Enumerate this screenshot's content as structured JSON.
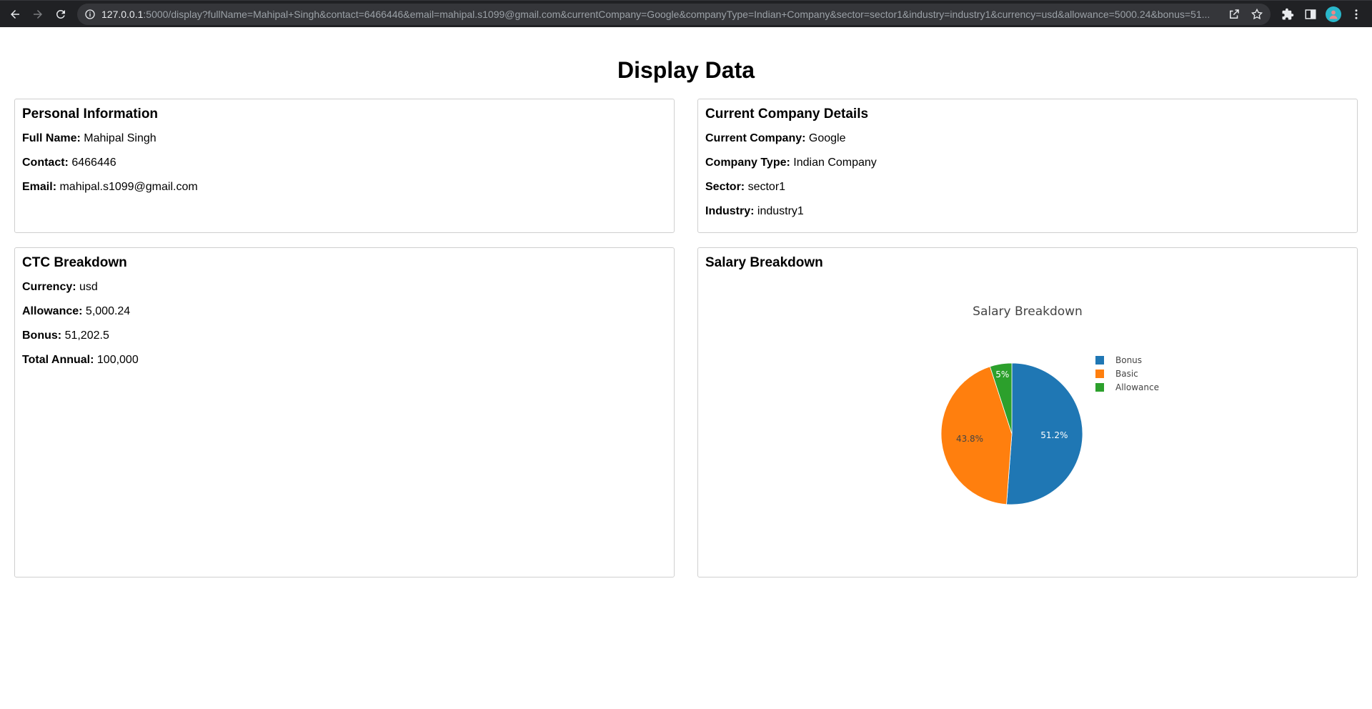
{
  "browser": {
    "url_host": "127.0.0.1",
    "url_rest": ":5000/display?fullName=Mahipal+Singh&contact=6466446&email=mahipal.s1099@gmail.com&currentCompany=Google&companyType=Indian+Company&sector=sector1&industry=industry1&currency=usd&allowance=5000.24&bonus=51..."
  },
  "page": {
    "title": "Display Data"
  },
  "personal": {
    "heading": "Personal Information",
    "full_name_label": "Full Name:",
    "full_name": "Mahipal Singh",
    "contact_label": "Contact:",
    "contact": "6466446",
    "email_label": "Email:",
    "email": "mahipal.s1099@gmail.com"
  },
  "company": {
    "heading": "Current Company Details",
    "current_company_label": "Current Company:",
    "current_company": "Google",
    "company_type_label": "Company Type:",
    "company_type": "Indian Company",
    "sector_label": "Sector:",
    "sector": "sector1",
    "industry_label": "Industry:",
    "industry": "industry1"
  },
  "ctc": {
    "heading": "CTC Breakdown",
    "currency_label": "Currency:",
    "currency": "usd",
    "allowance_label": "Allowance:",
    "allowance": "5,000.24",
    "bonus_label": "Bonus:",
    "bonus": "51,202.5",
    "total_label": "Total Annual:",
    "total": "100,000"
  },
  "salary": {
    "heading": "Salary Breakdown"
  },
  "chart_data": {
    "type": "pie",
    "title": "Salary Breakdown",
    "slices": [
      {
        "label": "Bonus",
        "value": 51202.5,
        "percent_label": "51.2%",
        "color": "#1f77b4",
        "text_color": "#ffffff"
      },
      {
        "label": "Basic",
        "value": 43797.26,
        "percent_label": "43.8%",
        "color": "#ff7f0e",
        "text_color": "#444444"
      },
      {
        "label": "Allowance",
        "value": 5000.24,
        "percent_label": "5%",
        "color": "#2ca02c",
        "text_color": "#ffffff"
      }
    ],
    "legend_position": "right"
  }
}
